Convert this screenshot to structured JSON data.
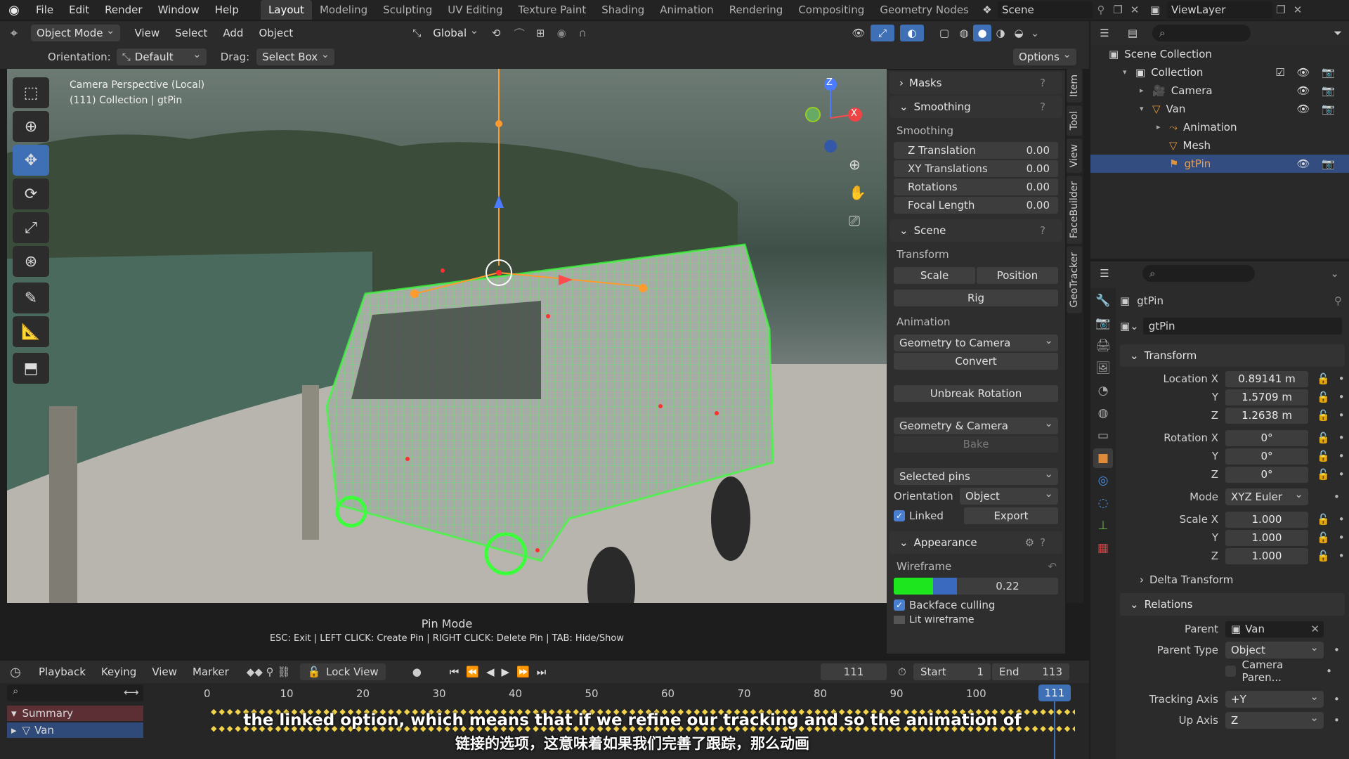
{
  "topbar": {
    "menus": [
      "File",
      "Edit",
      "Render",
      "Window",
      "Help"
    ],
    "workspaces": [
      "Layout",
      "Modeling",
      "Sculpting",
      "UV Editing",
      "Texture Paint",
      "Shading",
      "Animation",
      "Rendering",
      "Compositing",
      "Geometry Nodes"
    ],
    "scene": "Scene",
    "view_layer": "ViewLayer"
  },
  "viewport_header": {
    "mode": "Object Mode",
    "menus": [
      "View",
      "Select",
      "Add",
      "Object"
    ],
    "transform_orientation": "Global"
  },
  "tool_header": {
    "orientation_label": "Orientation:",
    "orientation_value": "Default",
    "drag_label": "Drag:",
    "drag_value": "Select Box",
    "options": "Options"
  },
  "viewport": {
    "info_line1": "Camera Perspective (Local)",
    "info_line2": "(111) Collection | gtPin",
    "mode_title": "Pin Mode",
    "mode_help": "ESC: Exit | LEFT CLICK: Create Pin | RIGHT CLICK: Delete Pin | TAB: Hide/Show",
    "gizmo_z": "Z",
    "gizmo_x": "X",
    "gizmo_y": "Y"
  },
  "side_tabs": [
    "Item",
    "Tool",
    "View",
    "FaceBuilder",
    "GeoTracker"
  ],
  "npanel": {
    "masks": "Masks",
    "smoothing": "Smoothing",
    "smoothing_sub": "Smoothing",
    "smoothing_fields": [
      {
        "label": "Z Translation",
        "value": "0.00"
      },
      {
        "label": "XY Translations",
        "value": "0.00"
      },
      {
        "label": "Rotations",
        "value": "0.00"
      },
      {
        "label": "Focal Length",
        "value": "0.00"
      }
    ],
    "scene": "Scene",
    "transform_sub": "Transform",
    "scale_btn": "Scale",
    "position_btn": "Position",
    "rig_btn": "Rig",
    "animation_sub": "Animation",
    "geo_to_cam": "Geometry to Camera",
    "convert_btn": "Convert",
    "unbreak_btn": "Unbreak Rotation",
    "geo_cam": "Geometry & Camera",
    "bake_btn": "Bake",
    "selected_pins": "Selected pins",
    "orientation_label": "Orientation",
    "orientation_value": "Object",
    "linked_label": "Linked",
    "export_btn": "Export",
    "appearance": "Appearance",
    "wireframe_label": "Wireframe",
    "wireframe_value": "0.22",
    "wireframe_color": "#1ee61e",
    "wireframe_color2": "#3a6ac0",
    "backface": "Backface culling",
    "lit_wireframe": "Lit wireframe"
  },
  "outliner": {
    "scene_collection": "Scene Collection",
    "items": [
      {
        "label": "Collection",
        "depth": 0
      },
      {
        "label": "Camera",
        "depth": 1
      },
      {
        "label": "Van",
        "depth": 1
      },
      {
        "label": "Animation",
        "depth": 2
      },
      {
        "label": "Mesh",
        "depth": 2
      },
      {
        "label": "gtPin",
        "depth": 2
      }
    ]
  },
  "properties": {
    "object_name": "gtPin",
    "data_name": "gtPin",
    "transform": "Transform",
    "location": [
      {
        "label": "Location X",
        "value": "0.89141 m"
      },
      {
        "label": "Y",
        "value": "1.5709 m"
      },
      {
        "label": "Z",
        "value": "1.2638 m"
      }
    ],
    "rotation": [
      {
        "label": "Rotation X",
        "value": "0°"
      },
      {
        "label": "Y",
        "value": "0°"
      },
      {
        "label": "Z",
        "value": "0°"
      }
    ],
    "mode_label": "Mode",
    "mode_value": "XYZ Euler",
    "scale": [
      {
        "label": "Scale X",
        "value": "1.000"
      },
      {
        "label": "Y",
        "value": "1.000"
      },
      {
        "label": "Z",
        "value": "1.000"
      }
    ],
    "delta": "Delta Transform",
    "relations": "Relations",
    "parent_label": "Parent",
    "parent_value": "Van",
    "parent_type_label": "Parent Type",
    "parent_type_value": "Object",
    "camera_parent": "Camera Paren...",
    "tracking_axis_label": "Tracking Axis",
    "tracking_axis_value": "+Y",
    "up_axis_label": "Up Axis",
    "up_axis_value": "Z"
  },
  "timeline": {
    "menus": [
      "Playback",
      "Keying",
      "View",
      "Marker"
    ],
    "lock_view": "Lock View",
    "current_frame": "111",
    "start_label": "Start",
    "start_value": "1",
    "end_label": "End",
    "end_value": "113",
    "ticks": [
      "0",
      "10",
      "20",
      "30",
      "40",
      "50",
      "60",
      "70",
      "80",
      "90",
      "100"
    ],
    "frame_marker": "111",
    "channels": [
      "Summary",
      "Van"
    ]
  },
  "subtitles": {
    "en": "the linked option, which means that if we refine our tracking and so the animation of",
    "zh": "链接的选项，这意味着如果我们完善了跟踪，那么动画"
  }
}
